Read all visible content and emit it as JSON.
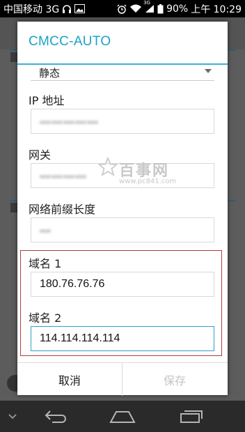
{
  "status_bar": {
    "carrier": "中国移动 3G",
    "network_badge": "3G",
    "battery": "90%",
    "time": "上午 10:29",
    "icons": [
      "headset-icon",
      "image-notification-icon",
      "alarm-icon",
      "wifi-icon",
      "signal-icon",
      "battery-icon"
    ]
  },
  "dialog": {
    "title": "CMCC-AUTO",
    "ip_setting": {
      "value": "静态"
    },
    "ip_address": {
      "label": "IP 地址"
    },
    "gateway": {
      "label": "网关"
    },
    "prefix_length": {
      "label": "网络前缀长度"
    },
    "dns1": {
      "label": "域名 1",
      "value": "180.76.76.76"
    },
    "dns2": {
      "label": "域名 2",
      "value": "114.114.114.114"
    },
    "buttons": {
      "cancel": "取消",
      "save": "保存"
    }
  },
  "watermark": {
    "name": "百事网",
    "url": "www.pc841.com"
  },
  "colors": {
    "accent": "#1aa3c4",
    "highlight_border": "#b23b3b",
    "disabled_text": "#c4c4c4"
  },
  "nav_bar": {
    "icons": [
      "chevron-down-icon",
      "back-icon",
      "home-icon",
      "recent-apps-icon"
    ]
  }
}
